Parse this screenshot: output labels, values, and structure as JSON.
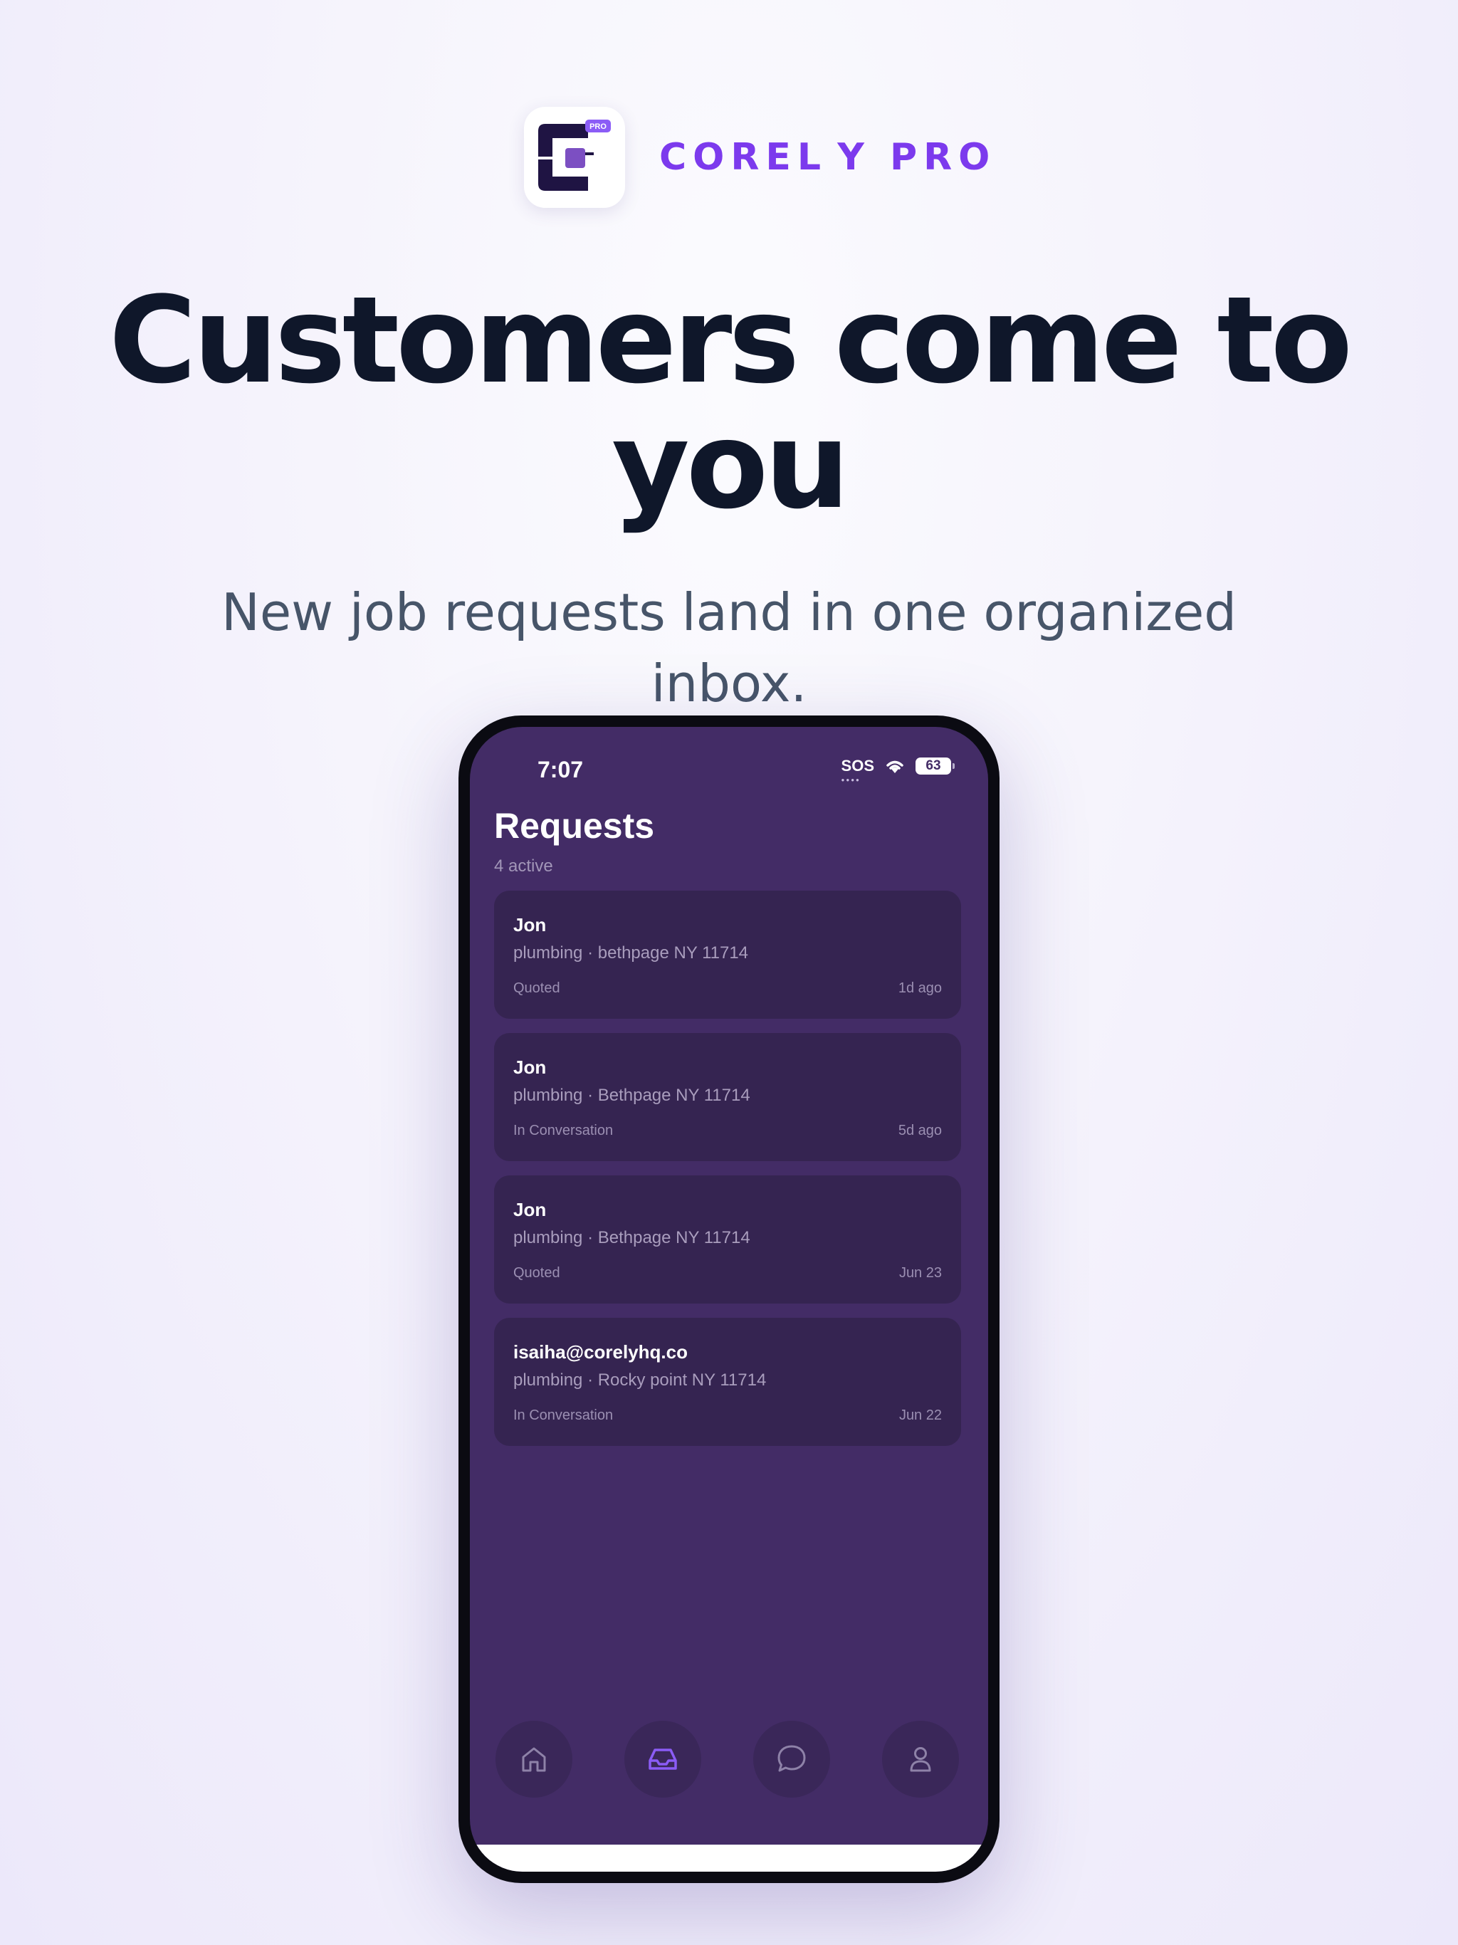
{
  "brand": {
    "app_icon": "corely-app-icon",
    "icon_badge": "PRO",
    "name": "COREL Y PRO"
  },
  "headline": "Customers come to you",
  "subheadline": "New job requests land in one organized inbox.",
  "phone": {
    "status_bar": {
      "time": "7:07",
      "sos": "SOS",
      "battery": "63",
      "wifi_icon": "wifi-icon"
    },
    "screen": {
      "title": "Requests",
      "subtitle": "4 active",
      "requests": [
        {
          "name": "Jon",
          "detail": "plumbing · bethpage NY 11714",
          "status": "Quoted",
          "time": "1d ago"
        },
        {
          "name": "Jon",
          "detail": "plumbing · Bethpage NY 11714",
          "status": "In Conversation",
          "time": "5d ago"
        },
        {
          "name": "Jon",
          "detail": "plumbing · Bethpage NY 11714",
          "status": "Quoted",
          "time": "Jun 23"
        },
        {
          "name": "isaiha@corelyhq.co",
          "detail": "plumbing · Rocky point NY 11714",
          "status": "In Conversation",
          "time": "Jun 22"
        }
      ],
      "tabs": [
        {
          "icon": "home-icon",
          "active": false
        },
        {
          "icon": "inbox-icon",
          "active": true
        },
        {
          "icon": "chat-bubble-icon",
          "active": false
        },
        {
          "icon": "profile-icon",
          "active": false
        }
      ]
    }
  },
  "colors": {
    "accent": "#7c3aed",
    "screen_background": "#432c66",
    "card_background": "#352451",
    "headline": "#0f172a"
  }
}
